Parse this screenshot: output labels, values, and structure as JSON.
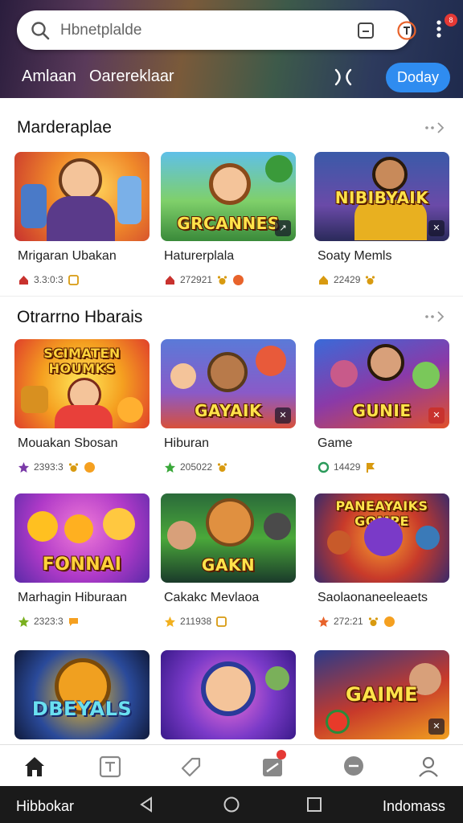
{
  "header": {
    "search_placeholder": "Hbnetplalde",
    "label_left": "Amlaan",
    "label_mid": "Oarereklaar",
    "today_button": "Doday",
    "badge_count": "8"
  },
  "sections": [
    {
      "title": "Marderaplae",
      "cards": [
        {
          "title": "Mrigaran Ubakan",
          "meta": "3.3:0:3",
          "art": ""
        },
        {
          "title": "Haturerplala",
          "meta": "272921",
          "art": "GRCANNES"
        },
        {
          "title": "Soaty Memls",
          "meta": "22429",
          "art": "NIBIBYAIK"
        }
      ]
    },
    {
      "title": "Otrarrno Hbarais",
      "cards": [
        {
          "title": "Mouakan Sbosan",
          "meta": "2393:3",
          "art": "SCIMATEN HOUMKS"
        },
        {
          "title": "Hiburan",
          "meta": "205022",
          "art": "GAYAIK"
        },
        {
          "title": "Game",
          "meta": "14429",
          "art": "GUNIE"
        },
        {
          "title": "Marhagin Hiburaan",
          "meta": "2323:3",
          "art": "FONNAI"
        },
        {
          "title": "Cakakc Mevlaoa",
          "meta": "211938",
          "art": "GAKN"
        },
        {
          "title": "Saolaonaneeleaets",
          "meta": "272:21",
          "art": "PANEAYAIKS GOMPE"
        },
        {
          "title": "",
          "meta": "",
          "art": "DBEYALS"
        },
        {
          "title": "",
          "meta": "",
          "art": ""
        },
        {
          "title": "",
          "meta": "",
          "art": "GAIME"
        }
      ]
    }
  ],
  "system_bar": {
    "left_label": "Hibbokar",
    "right_label": "Indomass"
  },
  "colors": {
    "accent": "#2f8cf0",
    "badge": "#e53935",
    "star": "#f2b01e"
  }
}
